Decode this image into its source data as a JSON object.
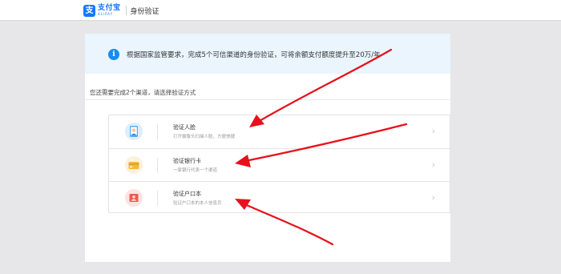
{
  "header": {
    "logo": {
      "cn": "支付宝",
      "en": "ALIPAY",
      "glyph": "支"
    },
    "title": "身份验证"
  },
  "notice": {
    "icon": "info-icon",
    "glyph": "i",
    "text": "根据国家监管要求，完成5个可信渠道的身份验证，可将余额支付额度提升至20万/年"
  },
  "prompt": "您还需要完成2个渠道，请选择验证方式",
  "options": [
    {
      "title": "验证人脸",
      "desc": "打开摄像头扫描人脸，方便快捷",
      "icon": "face-scan-icon"
    },
    {
      "title": "验证银行卡",
      "desc": "一家银行代表一个渠道",
      "icon": "bank-card-icon"
    },
    {
      "title": "验证户口本",
      "desc": "验证户口本的本人信息页",
      "icon": "household-register-icon"
    }
  ],
  "chevron": "›",
  "colors": {
    "brand": "#1677ff",
    "notice_bg": "#eaf5fe",
    "arrow": "#e8101b",
    "bank_card": "#f7b93a",
    "register": "#e95a55"
  }
}
